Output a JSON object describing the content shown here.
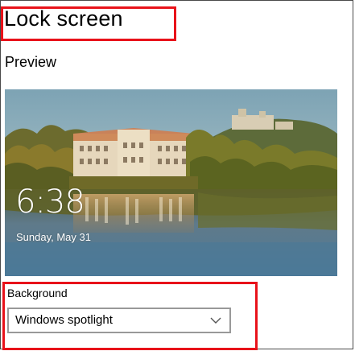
{
  "page": {
    "title": "Lock screen"
  },
  "preview": {
    "label": "Preview",
    "time": "6:38",
    "date": "Sunday, May 31"
  },
  "background": {
    "label": "Background",
    "selected": "Windows spotlight"
  },
  "icons": {
    "dropdown": "chevron-down-icon"
  },
  "colors": {
    "highlight": "#e8121a",
    "dropdown_border": "#999999",
    "text": "#000000"
  }
}
